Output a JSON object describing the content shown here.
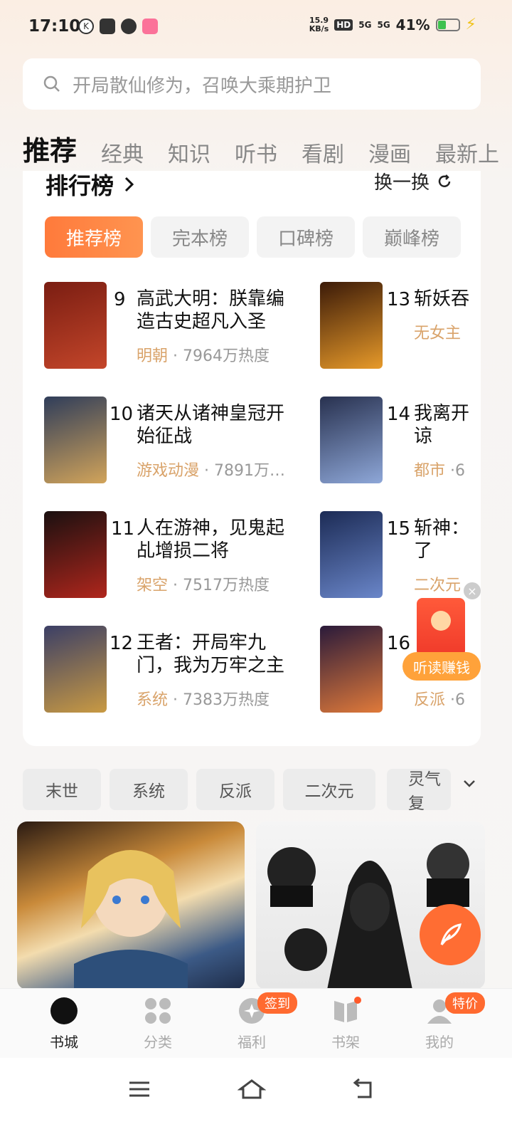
{
  "status": {
    "time": "17:10",
    "speed": "15.9\nKB/s",
    "network": "HD",
    "signal1": "5G",
    "signal2": "5G",
    "battery": "41%",
    "battery_level": 0.41
  },
  "search": {
    "placeholder": "开局散仙修为，召唤大乘期护卫"
  },
  "tabs": [
    "推荐",
    "经典",
    "知识",
    "听书",
    "看剧",
    "漫画",
    "最新上"
  ],
  "ranking": {
    "title": "排行榜",
    "refresh_label": "换一换",
    "pills": [
      "推荐榜",
      "完本榜",
      "口碑榜",
      "巅峰榜"
    ],
    "left_books": [
      {
        "num": "9",
        "title1": "高武大明：朕靠编",
        "title2": "造古史超凡入圣",
        "genre": "明朝",
        "heat": "7964万热度",
        "colors": [
          "#7a1d12",
          "#c4462a"
        ]
      },
      {
        "num": "10",
        "title1": "诸天从诸神皇冠开",
        "title2": "始征战",
        "genre": "游戏动漫",
        "heat": "7891万…",
        "colors": [
          "#2f3d5a",
          "#d2a45a"
        ]
      },
      {
        "num": "11",
        "title1": "人在游神，见鬼起",
        "title2": "乩增损二将",
        "genre": "架空",
        "heat": "7517万热度",
        "colors": [
          "#1a1010",
          "#b0261c"
        ]
      },
      {
        "num": "12",
        "title1": "王者：开局牢九",
        "title2": "门，我为万牢之主",
        "genre": "系统",
        "heat": "7383万热度",
        "colors": [
          "#3b3f66",
          "#c99a43"
        ]
      }
    ],
    "right_books": [
      {
        "num": "13",
        "title1": "斩妖吞",
        "title2": "",
        "genre": "无女主",
        "heat": "",
        "colors": [
          "#3b1a08",
          "#e79a2a"
        ]
      },
      {
        "num": "14",
        "title1": "我离开",
        "title2": "谅",
        "genre": "都市",
        "heat": "·6",
        "colors": [
          "#28314f",
          "#8ea7d8"
        ]
      },
      {
        "num": "15",
        "title1": "斩神：",
        "title2": "了",
        "genre": "二次元",
        "heat": "",
        "colors": [
          "#1c2b55",
          "#6a86c9"
        ]
      },
      {
        "num": "16",
        "title1": "",
        "title2": "",
        "genre": "反派",
        "heat": "·6",
        "colors": [
          "#2a1a3a",
          "#e07a3a"
        ]
      }
    ]
  },
  "float_promo": {
    "label": "听读赚钱",
    "close": "×"
  },
  "genre_chips": [
    "末世",
    "系统",
    "反派",
    "二次元",
    "灵气复"
  ],
  "bottom_nav": [
    {
      "label": "书城",
      "icon": "compass-icon",
      "active": true
    },
    {
      "label": "分类",
      "icon": "grid-icon",
      "active": false
    },
    {
      "label": "福利",
      "icon": "gift-icon",
      "active": false,
      "badge": "签到"
    },
    {
      "label": "书架",
      "icon": "bookshelf-icon",
      "active": false,
      "dot": true
    },
    {
      "label": "我的",
      "icon": "profile-icon",
      "active": false,
      "badge": "特价"
    }
  ],
  "colors": {
    "accent": "#ff7a3b",
    "genre": "#d9a36a"
  }
}
